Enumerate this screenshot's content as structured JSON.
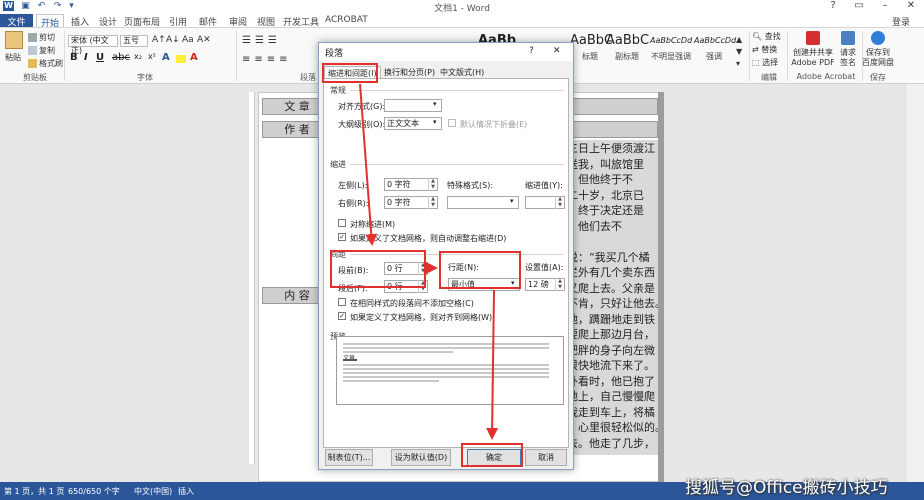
{
  "window": {
    "title": "文档1 - Word",
    "help": "?",
    "login": "登录"
  },
  "ribbon_tabs": [
    "文件",
    "开始",
    "插入",
    "设计",
    "页面布局",
    "引用",
    "邮件",
    "审阅",
    "视图",
    "开发工具",
    "ACROBAT"
  ],
  "clipboard": {
    "paste": "粘贴",
    "cut": "剪切",
    "copy": "复制",
    "format_painter": "格式刷",
    "group": "剪贴板"
  },
  "font": {
    "name": "宋体 (中文正)",
    "size": "五号",
    "group": "字体"
  },
  "paragraph_group": "段落",
  "styles": {
    "cards": [
      {
        "sample": "AaBbC",
        "name": "标题"
      },
      {
        "sample": "AaBbC",
        "name": "副标题"
      },
      {
        "sample": "AaBbCcDd",
        "name": "不明显强调"
      },
      {
        "sample": "AaBbCcDd",
        "name": "强调"
      }
    ],
    "top_card": "AaBb"
  },
  "editing": {
    "find": "查找",
    "replace": "替换",
    "select": "选择",
    "group": "编辑"
  },
  "acrobat": {
    "create_share": "创建并共享",
    "create_share_2": "Adobe PDF",
    "request_sign": "请求",
    "request_sign_2": "签名",
    "group": "Adobe Acrobat"
  },
  "save_group": {
    "save_to": "保存到",
    "save_to_2": "百度网盘",
    "group": "保存"
  },
  "document": {
    "label_article": "文    章",
    "label_author": "作    者",
    "label_content": "内    容",
    "text_lines": [
      "三日上午便须渡江",
      "送我，叫旅馆里",
      "。但他终于不",
      "二十岁，北京已",
      "，终于决定还是",
      "，他们去不",
      "",
      "说：“我买几个橘",
      "栏外有几个卖东西",
      "又爬上去。父亲是",
      "不肯，只好让他去。",
      "他，蹒跚地走到铁",
      "要爬上那边月台，",
      "肥胖的身子向左微",
      "很快地流下来了。",
      "外看时，他已抱了",
      "地上，自己慢慢爬",
      "我走到车上，将橘",
      "，心里很轻松似的。",
      "去。他走了几步，"
    ]
  },
  "status": {
    "page": "第 1 页，共 1 页",
    "words": "650/650 个字",
    "language": "中文(中国)",
    "mode": "插入"
  },
  "watermark": "搜狐号@Office搬砖小技巧",
  "dialog": {
    "title": "段落",
    "help": "?",
    "close": "✕",
    "tabs": [
      "缩进和间距(I)",
      "换行和分页(P)",
      "中文版式(H)"
    ],
    "general": {
      "section": "常规",
      "alignment_label": "对齐方式(G):",
      "alignment_value": "",
      "outline_label": "大纲级别(O):",
      "outline_value": "正文文本",
      "collapse_label": "默认情况下折叠(E)"
    },
    "indent": {
      "section": "缩进",
      "left_label": "左侧(L):",
      "left_value": "0 字符",
      "right_label": "右侧(R):",
      "right_value": "0 字符",
      "special_label": "特殊格式(S):",
      "special_value": "",
      "indent_by_label": "缩进值(Y):",
      "indent_by_value": "",
      "mirror_label": "对称缩进(M)",
      "grid_adjust_label": "如果定义了文档网格，则自动调整右缩进(D)",
      "mirror_checked": false,
      "grid_adjust_checked": true
    },
    "spacing": {
      "section": "间距",
      "before_label": "段前(B):",
      "before_value": "0 行",
      "after_label": "段后(F):",
      "after_value": "0 行",
      "line_label": "行距(N):",
      "line_value": "最小值",
      "at_label": "设置值(A):",
      "at_value": "12 磅",
      "no_space_label": "在相同样式的段落间不添加空格(C)",
      "snap_grid_label": "如果定义了文档网格，则对齐到网格(W)",
      "no_space_checked": false,
      "snap_grid_checked": true
    },
    "preview": {
      "section": "预览",
      "sample_word": "文章"
    },
    "buttons": {
      "tabs": "制表位(T)...",
      "default": "设为默认值(D)",
      "ok": "确定",
      "cancel": "取消"
    }
  },
  "annotation_color": "#e2302e",
  "accent_color": "#2b579a"
}
